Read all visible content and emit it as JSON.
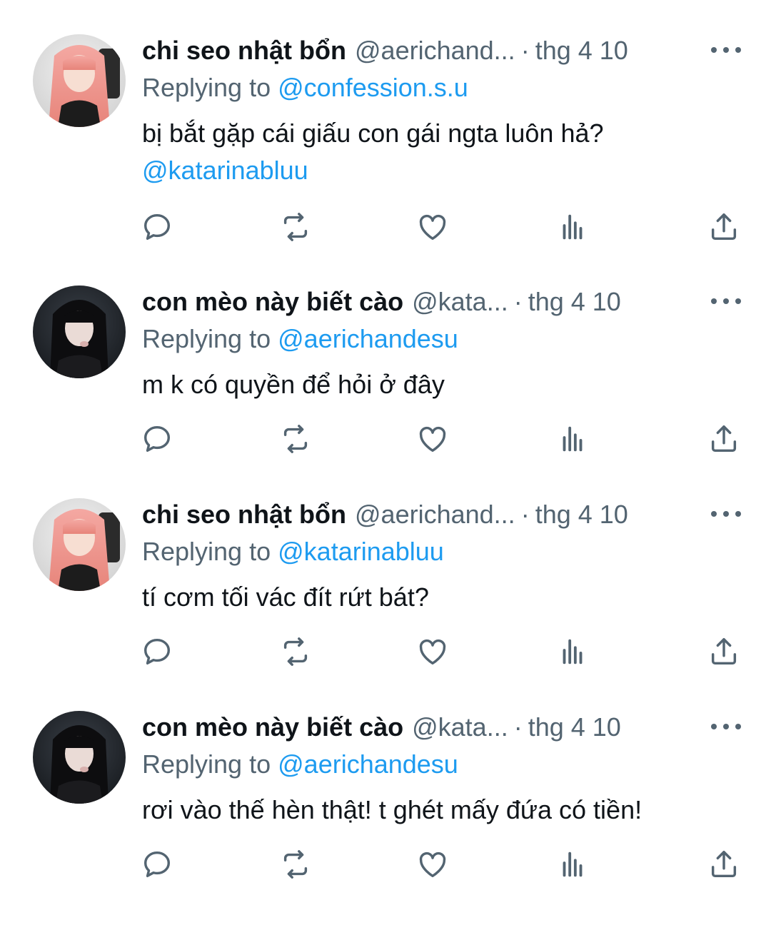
{
  "tweets": [
    {
      "author_name": "chi seo nhật bổn",
      "author_handle": "@aerichand...",
      "separator": "·",
      "time": "thg 4 10",
      "replying_prefix": "Replying to",
      "replying_handle": "@confession.s.u",
      "text": "bị bắt gặp cái giấu con gái ngta luôn hả?",
      "mention": "@katarinabluu",
      "avatar": "pink-hair-avatar"
    },
    {
      "author_name": "con mèo này biết cào",
      "author_handle": "@kata...",
      "separator": "·",
      "time": "thg 4 10",
      "replying_prefix": "Replying to",
      "replying_handle": "@aerichandesu",
      "text": "m k có quyền để hỏi ở đây",
      "avatar": "dark-hair-avatar"
    },
    {
      "author_name": "chi seo nhật bổn",
      "author_handle": "@aerichand...",
      "separator": "·",
      "time": "thg 4 10",
      "replying_prefix": "Replying to",
      "replying_handle": "@katarinabluu",
      "text": "tí cơm tối vác đít rứt bát?",
      "avatar": "pink-hair-avatar"
    },
    {
      "author_name": "con mèo này biết cào",
      "author_handle": "@kata...",
      "separator": "·",
      "time": "thg 4 10",
      "replying_prefix": "Replying to",
      "replying_handle": "@aerichandesu",
      "text": "rơi vào thế hèn thật! t ghét mấy đứa có tiền!",
      "avatar": "dark-hair-avatar"
    }
  ],
  "action_icons": [
    "reply-icon",
    "retweet-icon",
    "like-icon",
    "views-icon",
    "share-icon"
  ],
  "colors": {
    "text": "#0f1419",
    "secondary": "#536471",
    "link": "#1d9bf0",
    "background": "#ffffff"
  }
}
